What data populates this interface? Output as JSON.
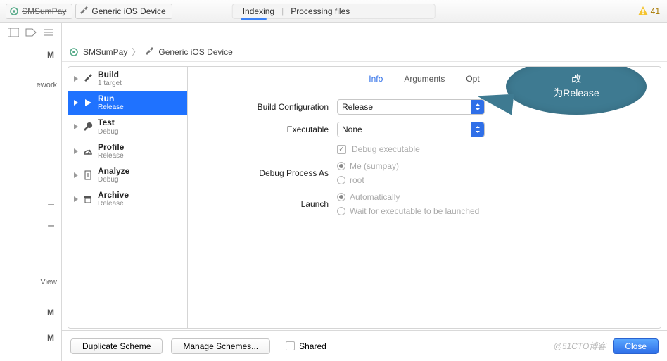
{
  "toolbar": {
    "project": "SMSumPay",
    "device": "Generic iOS Device",
    "status_left": "Indexing",
    "status_right": "Processing files",
    "warning_count": "41"
  },
  "nav": {
    "m": "M",
    "item1": "ework",
    "item2": "View"
  },
  "crumb": {
    "project": "SMSumPay",
    "device": "Generic iOS Device"
  },
  "schemes": [
    {
      "title": "Build",
      "sub": "1 target",
      "icon": "hammer"
    },
    {
      "title": "Run",
      "sub": "Release",
      "icon": "play",
      "selected": true
    },
    {
      "title": "Test",
      "sub": "Debug",
      "icon": "wrench"
    },
    {
      "title": "Profile",
      "sub": "Release",
      "icon": "gauge"
    },
    {
      "title": "Analyze",
      "sub": "Debug",
      "icon": "doc-eye"
    },
    {
      "title": "Archive",
      "sub": "Release",
      "icon": "archive"
    }
  ],
  "tabs": {
    "info": "Info",
    "arguments": "Arguments",
    "options": "Options"
  },
  "form": {
    "build_config_label": "Build Configuration",
    "build_config_value": "Release",
    "executable_label": "Executable",
    "executable_value": "None",
    "debug_exec": "Debug executable",
    "debug_as_label": "Debug Process As",
    "debug_as_me": "Me (sumpay)",
    "debug_as_root": "root",
    "launch_label": "Launch",
    "launch_auto": "Automatically",
    "launch_wait": "Wait for executable to be launched"
  },
  "callout": {
    "line1": "改",
    "line2": "为Release"
  },
  "footer": {
    "duplicate": "Duplicate Scheme",
    "manage": "Manage Schemes...",
    "shared": "Shared",
    "close": "Close",
    "watermark": "@51CTO博客"
  }
}
